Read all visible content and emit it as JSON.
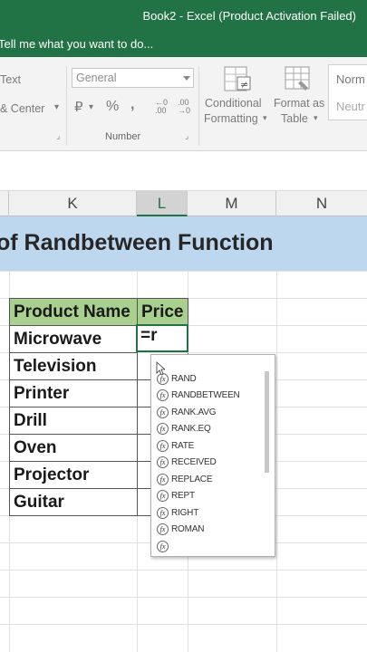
{
  "titlebar": {
    "title": "Book2 - Excel (Product Activation Failed)"
  },
  "tell": {
    "text": "Tell me what you want to do..."
  },
  "ribbon": {
    "text_partial": "Text",
    "merge_center": "& Center",
    "number_format": "General",
    "currency_symbol": "₽",
    "percent_symbol": "%",
    "comma_symbol": ",",
    "number_group_label": "Number",
    "conditional_formatting_line1": "Conditional",
    "conditional_formatting_line2": "Formatting",
    "format_as_table_line1": "Format as",
    "format_as_table_line2": "Table",
    "style_normal": "Norm",
    "style_neutral": "Neutr"
  },
  "columns": [
    {
      "name": "col-j",
      "label": ""
    },
    {
      "name": "col-k",
      "label": "K"
    },
    {
      "name": "col-l",
      "label": "L"
    },
    {
      "name": "col-m",
      "label": "M"
    },
    {
      "name": "col-n",
      "label": "N"
    }
  ],
  "sheet": {
    "banner": "of Randbetween Function",
    "header_product": "Product Name",
    "header_price": "Price",
    "products": [
      "Microwave",
      "Television",
      "Printer",
      "Drill",
      "Oven",
      "Projector",
      "Guitar"
    ],
    "active_cell_value": "=r"
  },
  "autocomplete": {
    "items": [
      "RAND",
      "RANDBETWEEN",
      "RANK.AVG",
      "RANK.EQ",
      "RATE",
      "RECEIVED",
      "REPLACE",
      "REPT",
      "RIGHT",
      "ROMAN",
      ""
    ]
  },
  "colors": {
    "excel_green": "#217346",
    "banner_blue": "#bdd7ee",
    "header_green": "#a9d08e"
  }
}
